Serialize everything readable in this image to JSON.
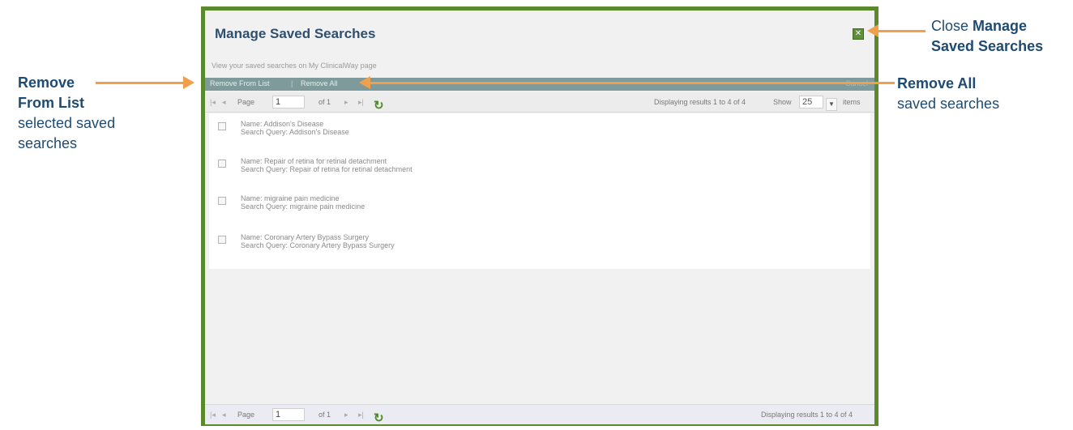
{
  "dialog": {
    "title": "Manage Saved Searches",
    "close_icon": "close-icon",
    "close_glyph": "✕",
    "subtitle": "View your saved searches on My ClinicalWay page",
    "actions": {
      "remove_from_list": "Remove From List",
      "separator": "|",
      "remove_all": "Remove All",
      "right_label": "Cancel"
    },
    "pager_top": {
      "first": "|◂",
      "prev": "◂",
      "page_label": "Page",
      "page_value": "1",
      "of_label": "of 1",
      "next": "▸",
      "last": "▸|",
      "refresh_icon": "refresh-icon",
      "refresh_glyph": "↻",
      "displaying": "Displaying results 1 to 4 of 4",
      "show_label": "Show",
      "show_value": "25",
      "dropdown_glyph": "▼",
      "items_label": "items"
    },
    "saved_searches": [
      {
        "name": "Name: Addison's Disease",
        "query": "Search Query: Addison's Disease"
      },
      {
        "name": "Name: Repair of retina for retinal detachment",
        "query": "Search Query: Repair of retina for retinal detachment"
      },
      {
        "name": "Name: migraine pain medicine",
        "query": "Search Query: migraine pain medicine"
      },
      {
        "name": "Name: Coronary Artery Bypass Surgery",
        "query": "Search Query: Coronary Artery Bypass Surgery"
      }
    ],
    "pager_bottom": {
      "first": "|◂",
      "prev": "◂",
      "page_label": "Page",
      "page_value": "1",
      "of_label": "of 1",
      "next": "▸",
      "last": "▸|",
      "refresh_glyph": "↻",
      "displaying": "Displaying results 1 to 4 of 4"
    }
  },
  "annotations": {
    "close": {
      "prefix": "Close ",
      "bold1": "Manage",
      "bold2": "Saved Searches"
    },
    "remove_from_list": {
      "bold1": "Remove",
      "bold2": "From List",
      "line3": "selected saved",
      "line4": "searches"
    },
    "remove_all": {
      "bold": "Remove All",
      "line2": "saved searches"
    }
  },
  "colors": {
    "dialog_border": "#5b8a2c",
    "title": "#2f4f6f",
    "action_bar": "#7f9a9a",
    "annotation_arrow": "#f0a04a",
    "annotation_text": "#1e4b72"
  }
}
